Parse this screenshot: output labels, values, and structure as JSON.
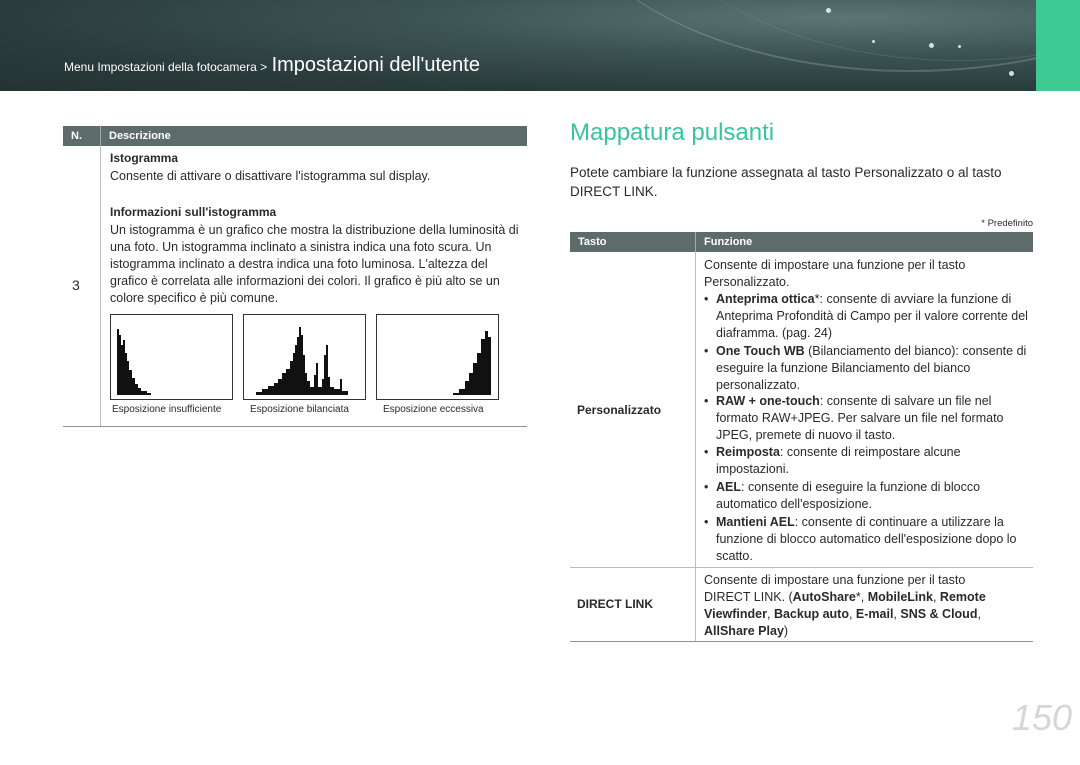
{
  "header": {
    "crumb_small": "Menu Impostazioni della fotocamera >",
    "crumb_large": "Impostazioni dell'utente"
  },
  "left_table": {
    "col_num": "N.",
    "col_desc": "Descrizione",
    "row_number": "3",
    "title1": "Istogramma",
    "text1": "Consente di attivare o disattivare l'istogramma sul display.",
    "title2": "Informazioni sull'istogramma",
    "text2": "Un istogramma è un grafico che mostra la distribuzione della luminosità di una foto. Un istogramma inclinato a sinistra indica una foto scura. Un istogramma inclinato a destra indica una foto luminosa. L'altezza del grafico è correlata alle informazioni dei colori. Il grafico è più alto se un colore specifico è più comune.",
    "captions": [
      "Esposizione insufficiente",
      "Esposizione bilanciata",
      "Esposizione eccessiva"
    ]
  },
  "right": {
    "title": "Mappatura pulsanti",
    "intro": "Potete cambiare la funzione assegnata al tasto Personalizzato o al tasto DIRECT LINK.",
    "note": "* Predefinito",
    "col_key": "Tasto",
    "col_func": "Funzione",
    "row1_key": "Personalizzato",
    "row1_intro": "Consente di impostare una funzione per il tasto Personalizzato.",
    "bullets": [
      {
        "bold": "Anteprima ottica",
        "rest": "*: consente di avviare la funzione di Anteprima Profondità di Campo per il valore corrente del diaframma. (pag. 24)"
      },
      {
        "bold": "One Touch WB",
        "rest": " (Bilanciamento del bianco): consente di eseguire la funzione Bilanciamento del bianco personalizzato."
      },
      {
        "bold": "RAW + one-touch",
        "rest": ": consente di salvare un file nel formato RAW+JPEG. Per salvare un file nel formato JPEG, premete di nuovo il tasto."
      },
      {
        "bold": "Reimposta",
        "rest": ": consente di reimpostare alcune impostazioni."
      },
      {
        "bold": "AEL",
        "rest": ": consente di eseguire la funzione di blocco automatico dell'esposizione."
      },
      {
        "bold": "Mantieni AEL",
        "rest": ": consente di continuare a utilizzare la funzione di blocco automatico dell'esposizione dopo lo scatto."
      }
    ],
    "row2_key": "DIRECT LINK",
    "row2_line1": "Consente di impostare una funzione per il tasto",
    "row2_line2_a": "DIRECT LINK. (",
    "row2_line2_b": "AutoShare",
    "row2_line2_c": "*, ",
    "row2_line2_d": "MobileLink",
    "row2_line2_e": ", ",
    "row2_line2_f": "Remote",
    "row2_line3_a": "Viewfinder",
    "row2_line3_b": ", ",
    "row2_line3_c": "Backup auto",
    "row2_line3_d": ", ",
    "row2_line3_e": "E-mail",
    "row2_line3_f": ", ",
    "row2_line3_g": "SNS & Cloud",
    "row2_line3_h": ",",
    "row2_line4_a": "AllShare Play",
    "row2_line4_b": ")"
  },
  "page_number": "150"
}
